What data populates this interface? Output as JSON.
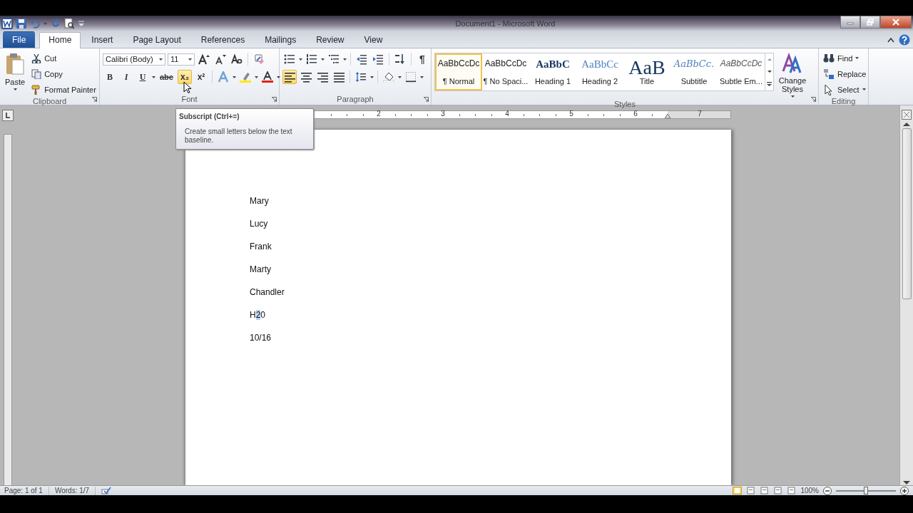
{
  "window": {
    "title": "Document1 - Microsoft Word"
  },
  "tabs": [
    {
      "label": "File",
      "kind": "file",
      "selected": false
    },
    {
      "label": "Home",
      "kind": "tab",
      "selected": true
    },
    {
      "label": "Insert",
      "kind": "tab",
      "selected": false
    },
    {
      "label": "Page Layout",
      "kind": "tab",
      "selected": false
    },
    {
      "label": "References",
      "kind": "tab",
      "selected": false
    },
    {
      "label": "Mailings",
      "kind": "tab",
      "selected": false
    },
    {
      "label": "Review",
      "kind": "tab",
      "selected": false
    },
    {
      "label": "View",
      "kind": "tab",
      "selected": false
    }
  ],
  "ribbon": {
    "clipboard": {
      "label": "Clipboard",
      "paste": "Paste",
      "items": [
        {
          "kind": "cut",
          "label": "Cut"
        },
        {
          "kind": "copy",
          "label": "Copy"
        },
        {
          "kind": "painter",
          "label": "Format Painter"
        }
      ]
    },
    "font": {
      "label": "Font",
      "font_name": "Calibri (Body)",
      "font_size": "11",
      "buttons": [
        {
          "kind": "bold",
          "label": "B",
          "highlighted": false
        },
        {
          "kind": "italic",
          "label": "I",
          "highlighted": false
        },
        {
          "kind": "underline",
          "label": "U",
          "highlighted": false
        },
        {
          "kind": "strike",
          "label": "abc",
          "highlighted": false
        },
        {
          "kind": "subscript",
          "label": "x₂",
          "highlighted": true
        },
        {
          "kind": "superscript",
          "label": "x²",
          "highlighted": false
        }
      ]
    },
    "paragraph": {
      "label": "Paragraph",
      "show_marks": "¶",
      "align": [
        {
          "kind": "left",
          "selected": true
        },
        {
          "kind": "center",
          "selected": false
        },
        {
          "kind": "right",
          "selected": false
        },
        {
          "kind": "justify",
          "selected": false
        }
      ]
    },
    "styles": {
      "label": "Styles",
      "change_styles": "Change Styles",
      "items": [
        {
          "kind": "normal",
          "preview": "AaBbCcDc",
          "name": "¶ Normal",
          "selected": true
        },
        {
          "kind": "nospace",
          "preview": "AaBbCcDc",
          "name": "¶ No Spaci...",
          "selected": false
        },
        {
          "kind": "heading1",
          "preview": "AaBbC",
          "name": "Heading 1",
          "selected": false
        },
        {
          "kind": "heading2",
          "preview": "AaBbCc",
          "name": "Heading 2",
          "selected": false
        },
        {
          "kind": "title",
          "preview": "AaB",
          "name": "Title",
          "selected": false
        },
        {
          "kind": "subtitle",
          "preview": "AaBbCc.",
          "name": "Subtitle",
          "selected": false
        },
        {
          "kind": "emphasis",
          "preview": "AaBbCcDc",
          "name": "Subtle Em...",
          "selected": false
        }
      ]
    },
    "editing": {
      "label": "Editing",
      "items": [
        {
          "kind": "find",
          "label": "Find"
        },
        {
          "kind": "replace",
          "label": "Replace"
        },
        {
          "kind": "select",
          "label": "Select"
        }
      ]
    }
  },
  "ruler": {
    "numbers": [
      "2",
      "3",
      "4",
      "5",
      "6",
      "7"
    ]
  },
  "document": {
    "lines": [
      {
        "parts": [
          {
            "text": "Mary",
            "selected": false
          }
        ]
      },
      {
        "parts": [
          {
            "text": "Lucy",
            "selected": false
          }
        ]
      },
      {
        "parts": [
          {
            "text": "Frank",
            "selected": false
          }
        ]
      },
      {
        "parts": [
          {
            "text": "Marty",
            "selected": false
          }
        ]
      },
      {
        "parts": [
          {
            "text": "Chandler",
            "selected": false
          }
        ]
      },
      {
        "parts": [
          {
            "text": "H",
            "selected": false
          },
          {
            "text": "2",
            "selected": true
          },
          {
            "text": "0",
            "selected": false
          }
        ]
      },
      {
        "parts": [
          {
            "text": "10/16",
            "selected": false
          }
        ]
      }
    ]
  },
  "tooltip": {
    "title": "Subscript (Ctrl+=)",
    "text": "Create small letters below the text baseline."
  },
  "status_bar": {
    "page": "Page: 1 of 1",
    "words": "Words: 1/7",
    "zoom": "100%",
    "zoom_slider": {
      "level": 0.5
    }
  }
}
